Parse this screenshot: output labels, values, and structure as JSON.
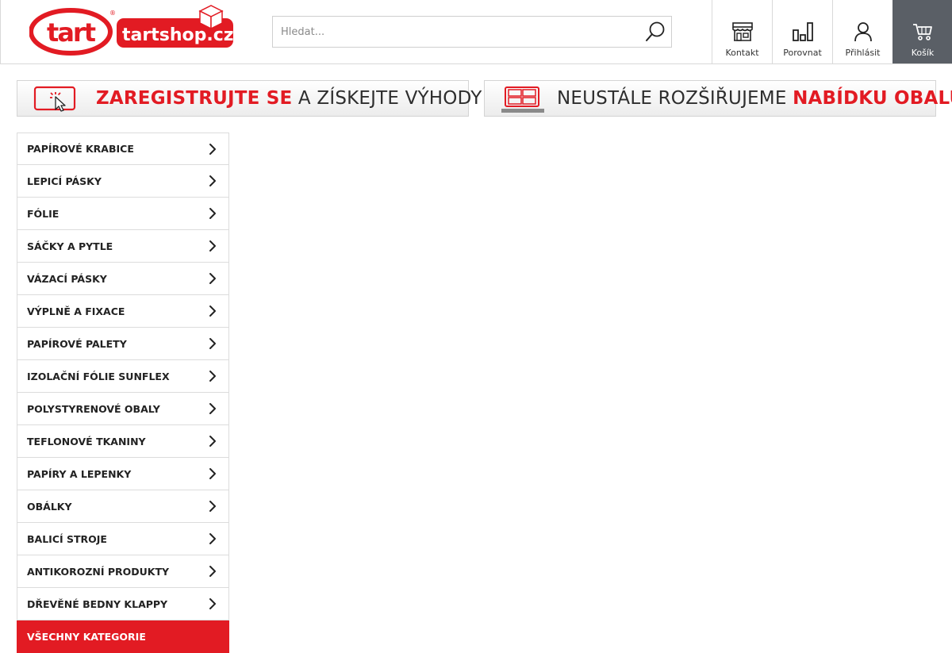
{
  "header": {
    "logo": {
      "brand_mark": "tart",
      "brand_name": "tartshop.cz"
    },
    "search": {
      "placeholder": "Hledat...",
      "value": "",
      "icon": "search-icon"
    },
    "nav": [
      {
        "label": "Kontakt",
        "icon": "store-icon"
      },
      {
        "label": "Porovnat",
        "icon": "compare-chart-icon"
      },
      {
        "label": "Přihlásit",
        "icon": "user-icon"
      },
      {
        "label": "Košík",
        "icon": "cart-icon"
      }
    ]
  },
  "banners": [
    {
      "highlight": "ZAREGISTRUJTE SE",
      "text": " A ZÍSKEJTE VÝHODY",
      "icon": "click-screen-icon"
    },
    {
      "text": "NEUSTÁLE ROZŠIŘUJEME ",
      "highlight": "NABÍDKU OBALŮ",
      "icon": "grid-boxes-icon"
    }
  ],
  "sidebar": {
    "categories": [
      {
        "label": "PAPÍROVÉ KRABICE"
      },
      {
        "label": "LEPICÍ PÁSKY"
      },
      {
        "label": "FÓLIE"
      },
      {
        "label": "SÁČKY A PYTLE"
      },
      {
        "label": "VÁZACÍ PÁSKY"
      },
      {
        "label": "VÝPLNĚ A FIXACE"
      },
      {
        "label": "PAPÍROVÉ PALETY"
      },
      {
        "label": "IZOLAČNÍ FÓLIE SUNFLEX"
      },
      {
        "label": "POLYSTYRENOVÉ OBALY"
      },
      {
        "label": "TEFLONOVÉ TKANINY"
      },
      {
        "label": "PAPÍRY A LEPENKY"
      },
      {
        "label": "OBÁLKY"
      },
      {
        "label": "BALICÍ STROJE"
      },
      {
        "label": "ANTIKOROZNÍ PRODUKTY"
      },
      {
        "label": "DŘEVĚNÉ BEDNY KLAPPY"
      }
    ],
    "all_categories": {
      "label": "VŠECHNY KATEGORIE"
    }
  },
  "colors": {
    "brand_red": "#e21b23",
    "cart_bg": "#5a5f66",
    "border": "#dcdcdc"
  }
}
